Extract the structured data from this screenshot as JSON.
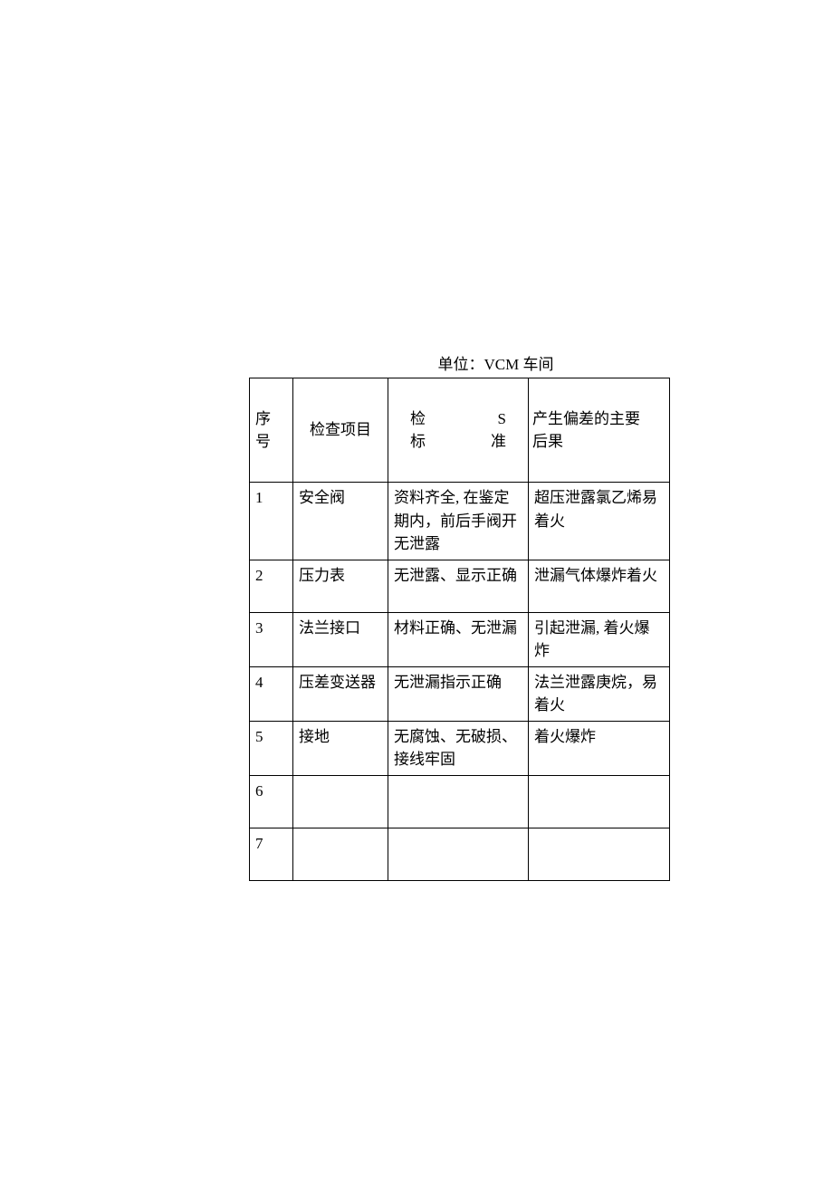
{
  "title": "单位：VCM 车间",
  "headers": {
    "seq_1": "序",
    "seq_2": "号",
    "item": "检查项目",
    "std_char1": "检",
    "std_char2": "S",
    "std_char3": "标",
    "std_char4": "准",
    "result_1": "产生偏差的主要",
    "result_2": "后果"
  },
  "rows": [
    {
      "seq": "1",
      "item": "安全阀",
      "std": "资料齐全, 在鉴定期内，前后手阀开无泄露",
      "result": "超压泄露氯乙烯易着火"
    },
    {
      "seq": "2",
      "item": "压力表",
      "std": "无泄露、显示正确",
      "result": "泄漏气体爆炸着火"
    },
    {
      "seq": "3",
      "item": "法兰接口",
      "std": "材料正确、无泄漏",
      "result": "引起泄漏, 着火爆炸"
    },
    {
      "seq": "4",
      "item": "压差变送器",
      "std": "无泄漏指示正确",
      "result": "法兰泄露庚烷，易着火"
    },
    {
      "seq": "5",
      "item": "接地",
      "std": "无腐蚀、无破损、接线牢固",
      "result": "着火爆炸"
    },
    {
      "seq": "6",
      "item": "",
      "std": "",
      "result": ""
    },
    {
      "seq": "7",
      "item": "",
      "std": "",
      "result": ""
    }
  ]
}
